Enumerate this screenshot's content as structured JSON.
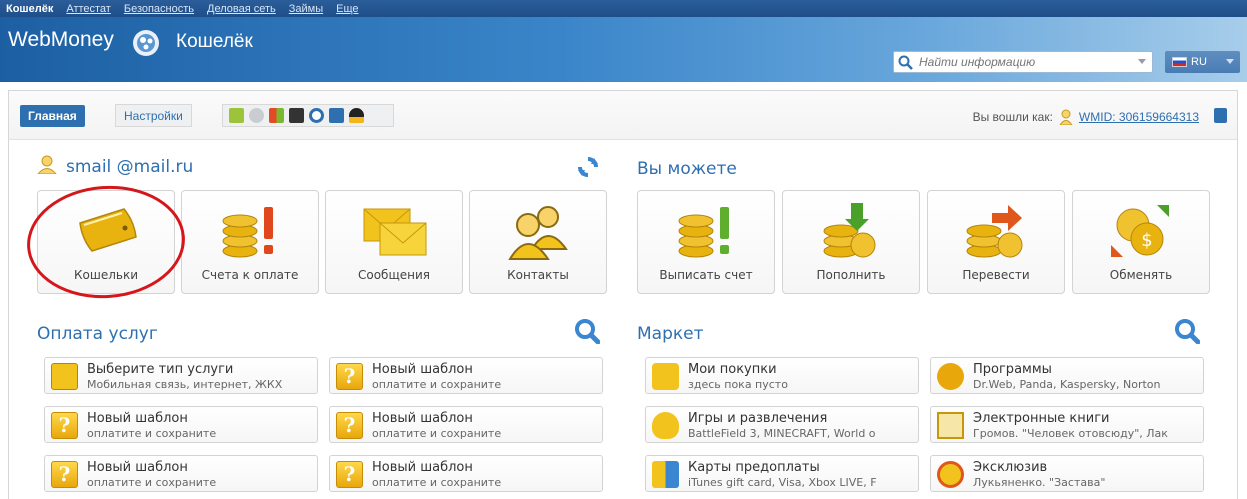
{
  "topnav": {
    "items": [
      "Кошелёк",
      "Аттестат",
      "Безопасность",
      "Деловая сеть",
      "Займы",
      "Еще"
    ]
  },
  "header": {
    "brand": "WebMoney",
    "subtitle": "Кошелёк",
    "search_placeholder": "Найти информацию",
    "lang": "RU"
  },
  "tabs": {
    "main": "Главная",
    "settings": "Настройки",
    "platform_icons": [
      "android-icon",
      "apple-icon",
      "windows-icon",
      "blackberry-icon",
      "opera-icon",
      "windows-phone-icon",
      "linux-icon"
    ]
  },
  "login": {
    "label": "Вы вошли как:",
    "wmid": "WMID: 306159664313"
  },
  "account": {
    "email": "smail @mail.ru"
  },
  "main_tiles": [
    {
      "label": "Кошельки",
      "icon": "wallet-icon"
    },
    {
      "label": "Счета к оплате",
      "icon": "invoice-coins-icon"
    },
    {
      "label": "Сообщения",
      "icon": "envelope-icon"
    },
    {
      "label": "Контакты",
      "icon": "contacts-icon"
    }
  ],
  "actions": {
    "title": "Вы можете",
    "tiles": [
      {
        "label": "Выписать счет",
        "icon": "issue-invoice-icon"
      },
      {
        "label": "Пополнить",
        "icon": "top-up-icon"
      },
      {
        "label": "Перевести",
        "icon": "transfer-icon"
      },
      {
        "label": "Обменять",
        "icon": "exchange-icon"
      }
    ]
  },
  "services": {
    "title": "Оплата услуг",
    "items": [
      {
        "title": "Выберите тип услуги",
        "subtitle": "Мобильная связь, интернет, ЖКХ"
      },
      {
        "title": "Новый шаблон",
        "subtitle": "оплатите и сохраните"
      },
      {
        "title": "Новый шаблон",
        "subtitle": "оплатите и сохраните"
      },
      {
        "title": "Новый шаблон",
        "subtitle": "оплатите и сохраните"
      },
      {
        "title": "Новый шаблон",
        "subtitle": "оплатите и сохраните"
      },
      {
        "title": "Новый шаблон",
        "subtitle": "оплатите и сохраните"
      }
    ]
  },
  "market": {
    "title": "Маркет",
    "items": [
      {
        "title": "Мои покупки",
        "subtitle": "здесь пока пусто"
      },
      {
        "title": "Программы",
        "subtitle": "Dr.Web, Panda, Kaspersky, Norton"
      },
      {
        "title": "Игры и развлечения",
        "subtitle": "BattleField 3, MINECRAFT, World o"
      },
      {
        "title": "Электронные книги",
        "subtitle": "Громов. \"Человек отовсюду\", Лак"
      },
      {
        "title": "Карты предоплаты",
        "subtitle": "iTunes gift card, Visa, Xbox LIVE, F"
      },
      {
        "title": "Эксклюзив",
        "subtitle": "Лукьяненко. \"Застава\""
      }
    ]
  },
  "colors": {
    "accent": "#2e6fb0",
    "highlight": "#d5171c",
    "coin": "#e8b20f"
  }
}
